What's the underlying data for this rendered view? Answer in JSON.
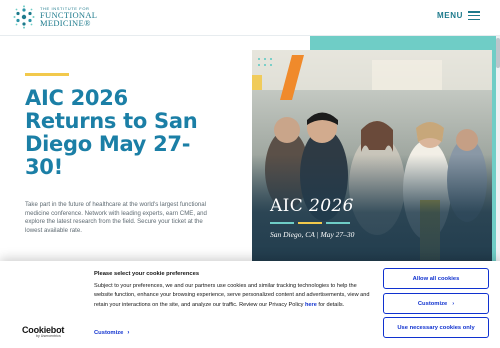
{
  "header": {
    "logo": {
      "line1": "THE INSTITUTE FOR",
      "line2": "FUNCTIONAL",
      "line3": "MEDICINE®"
    },
    "menu_label": "MENU"
  },
  "hero": {
    "title": "AIC 2026 Returns to San Diego May 27-30!",
    "body": "Take part in the future of healthcare at the world's largest functional medicine conference. Network with leading experts, earn CME, and explore the latest research from the field. Secure your ticket at the lowest available rate."
  },
  "event_graphic": {
    "title_prefix": "AIC ",
    "title_year": "2026",
    "subtitle": "San Diego, CA | May 27–30",
    "colors": {
      "teal": "#6fcdc6",
      "navy": "#1f3b4d",
      "orange": "#f08a2b",
      "yellow": "#f2c94c"
    }
  },
  "cookie_banner": {
    "heading": "Please select your cookie preferences",
    "text_before_link": "Subject to your preferences, we and our partners use cookies and similar tracking technologies to help the website function, enhance your browsing experience, serve personalized content and advertisements, view and retain your interactions on the site, and analyze our traffic. Review our Privacy Policy ",
    "link_text": "here",
    "text_after_link": " for details.",
    "customize_link": "Customize",
    "buttons": {
      "allow_all": "Allow all cookies",
      "customize": "Customize",
      "necessary_only": "Use necessary cookies only"
    },
    "brand": {
      "name": "Cookiebot",
      "byline": "by Usercentrics"
    }
  }
}
